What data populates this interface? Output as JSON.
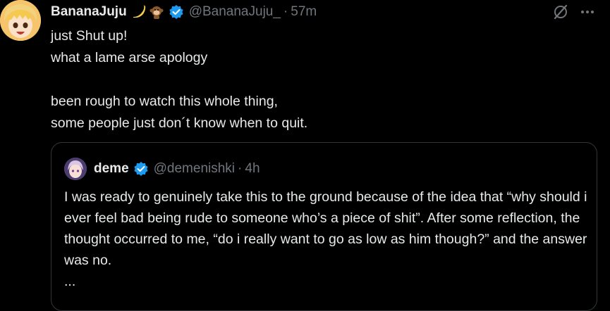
{
  "tweet": {
    "author_name": "BananaJuju",
    "author_handle": "@BananaJuju_",
    "separator": "·",
    "time": "57m",
    "name_emojis": [
      "banana-icon",
      "monkey-icon"
    ],
    "text": "just Shut up!\nwhat a lame arse apology\n\nbeen rough to watch this whole thing,\nsome people  just don´t know when to quit."
  },
  "quoted": {
    "author_name": "deme",
    "author_handle": "@demenishki",
    "separator": "·",
    "time": "4h",
    "text": "I was ready to genuinely take this to the ground because of the idea that “why should i ever feel bad being rude to someone who’s a piece of shit”. After some reflection, the thought occurred to me, “do i really want to go as low as him though?” and the answer was no.",
    "ellipsis": "..."
  },
  "icons": {
    "grok": "grok-icon",
    "more": "more-icon",
    "verified": "verified-icon"
  },
  "colors": {
    "background": "#000000",
    "text": "#e7e9ea",
    "secondary": "#71767b",
    "verified": "#1d9bf0",
    "border": "#333639"
  }
}
